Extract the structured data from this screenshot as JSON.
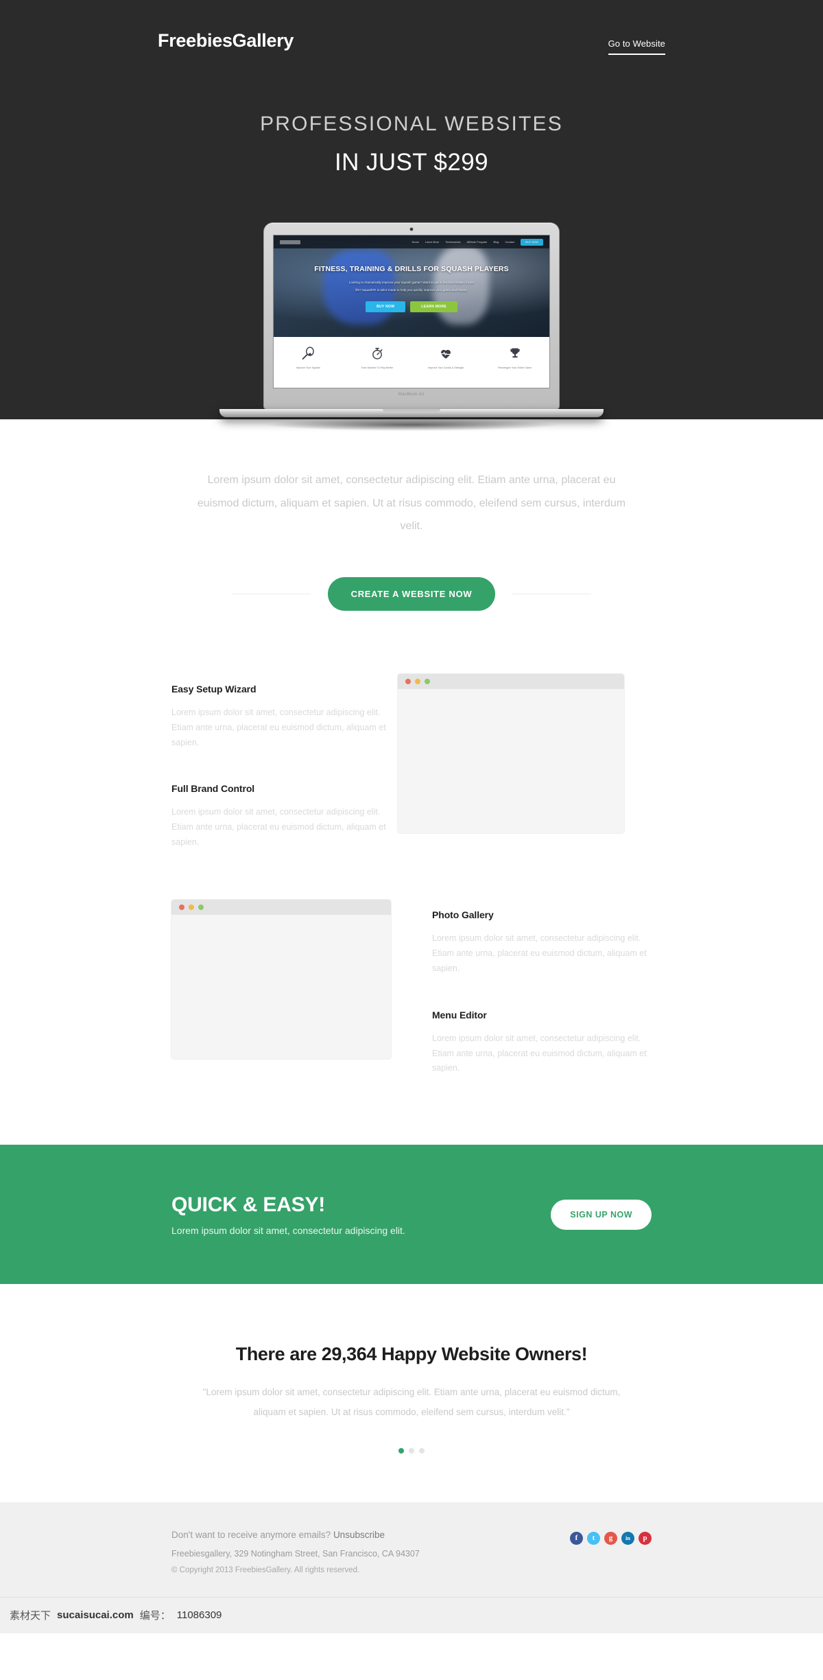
{
  "hero": {
    "brand": "FreebiesGallery",
    "nav_link": "Go to Website",
    "subtitle": "PROFESSIONAL WEBSITES",
    "title": "IN JUST $299"
  },
  "laptop": {
    "model_label": "MacBook Air",
    "site": {
      "nav_items": [
        "Home",
        "Learn More",
        "Testimonials",
        "Affiliate Program",
        "Blog",
        "Contact"
      ],
      "nav_button": "BUY NOW",
      "headline": "FITNESS, TRAINING & DRILLS FOR SQUASH PLAYERS",
      "paragraph_line1": "Looking to dramatically improve your squash game? Want to get in the best shape of your",
      "paragraph_line2": "life? SquashFit is tailor-made to help you quickly improve your game and fitness.",
      "btn_primary": "BUY NOW",
      "btn_secondary": "LEARN MORE",
      "features": [
        {
          "icon": "racket-icon",
          "caption": "Improve Your Squash"
        },
        {
          "icon": "stopwatch-icon",
          "caption": "Train Smarter To Play Better"
        },
        {
          "icon": "heart-pulse-icon",
          "caption": "Improve Your Cardio & Strength"
        },
        {
          "icon": "trophy-icon",
          "caption": "Reenergize Your Entire Game"
        }
      ]
    }
  },
  "intro": {
    "paragraph": "Lorem ipsum dolor sit amet, consectetur adipiscing elit. Etiam ante urna, placerat eu euismod dictum, aliquam et sapien. Ut at risus commodo, eleifend sem cursus, interdum velit."
  },
  "cta": {
    "button_label": "CREATE A WEBSITE NOW"
  },
  "features": {
    "left": [
      {
        "title": "Easy Setup Wizard",
        "body": "Lorem ipsum dolor sit amet, consectetur adipiscing elit. Etiam ante urna, placerat eu euismod dictum, aliquam et sapien."
      },
      {
        "title": "Full Brand Control",
        "body": "Lorem ipsum dolor sit amet, consectetur adipiscing elit. Etiam ante urna, placerat eu euismod dictum, aliquam et sapien."
      }
    ],
    "right": [
      {
        "title": "Photo Gallery",
        "body": "Lorem ipsum dolor sit amet, consectetur adipiscing elit. Etiam ante urna, placerat eu euismod dictum, aliquam et sapien."
      },
      {
        "title": "Menu Editor",
        "body": "Lorem ipsum dolor sit amet, consectetur adipiscing elit. Etiam ante urna, placerat eu euismod dictum, aliquam et sapien."
      }
    ],
    "browser_dots": [
      "#e8705a",
      "#edbb4d",
      "#8dc96a"
    ]
  },
  "banner": {
    "title": "QUICK & EASY!",
    "subtitle": "Lorem ipsum dolor sit amet, consectetur adipiscing elit.",
    "button_label": "SIGN UP NOW"
  },
  "testimonial": {
    "heading": "There are 29,364 Happy Website Owners!",
    "quote": "\"Lorem ipsum dolor sit amet, consectetur adipiscing elit. Etiam ante urna, placerat eu euismod dictum, aliquam et sapien. Ut at risus commodo, eleifend sem cursus, interdum velit.\"",
    "dots_total": 3,
    "dot_active_index": 0
  },
  "footer": {
    "unsubscribe_text": "Don't want to receive anymore emails? ",
    "unsubscribe_link": "Unsubscribe",
    "address": "Freebiesgallery, 329 Notingham Street, San Francisco, CA 94307",
    "copyright": "© Copyright 2013 FreebiesGallery. All rights reserved.",
    "socials": [
      {
        "name": "facebook-icon",
        "glyph": "f",
        "color": "#3b5998"
      },
      {
        "name": "twitter-icon",
        "glyph": "t",
        "color": "#46c0f5"
      },
      {
        "name": "googleplus-icon",
        "glyph": "g",
        "color": "#e4584a"
      },
      {
        "name": "linkedin-icon",
        "glyph": "in",
        "color": "#1278ae"
      },
      {
        "name": "pinterest-icon",
        "glyph": "p",
        "color": "#d6313d"
      }
    ]
  },
  "watermark": {
    "label": "素材天下",
    "site": "sucaisucai.com",
    "number_label": "编号：",
    "number": "11086309"
  },
  "colors": {
    "accent_green": "#35a269",
    "hero_dark": "#2b2b2b",
    "footer_gray": "#f0f0f0"
  }
}
